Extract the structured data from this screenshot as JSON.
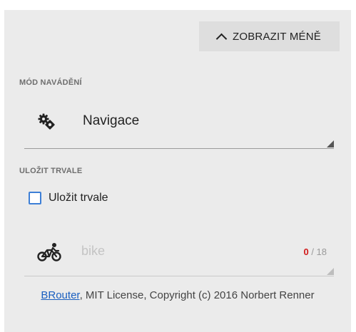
{
  "toggle": {
    "label": "ZOBRAZIT MÉNĚ",
    "icon": "chevron-up-icon"
  },
  "routing_mode": {
    "section_label": "MÓD NAVÁDĚNÍ",
    "value": "Navigace",
    "icon": "gears-icon"
  },
  "save": {
    "section_label": "ULOŽIT TRVALE",
    "checkbox_label": "Uložit trvale",
    "checked": false,
    "checkbox_color": "#3d7fd6"
  },
  "profile": {
    "icon": "bicycle-icon",
    "placeholder": "bike",
    "value": "",
    "counter_current": "0",
    "counter_max": "/ 18",
    "counter_color": "#d11a1a"
  },
  "license": {
    "link_text": "BRouter",
    "text": ", MIT License, Copyright (c) 2016 Norbert Renner"
  }
}
